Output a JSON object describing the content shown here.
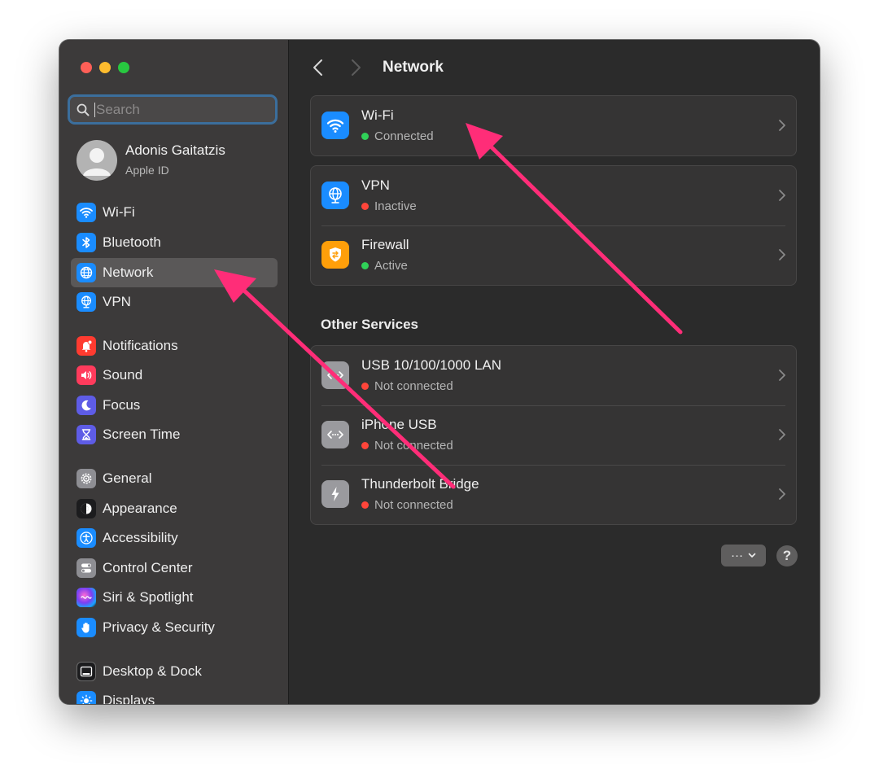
{
  "window": {
    "title": "Network",
    "sidebar": {
      "search_placeholder": "Search",
      "profile": {
        "name": "Adonis Gaitatzis",
        "subtitle": "Apple ID"
      },
      "items": [
        {
          "label": "Wi-Fi",
          "icon": "wifi-icon"
        },
        {
          "label": "Bluetooth",
          "icon": "bluetooth-icon"
        },
        {
          "label": "Network",
          "icon": "globe-icon",
          "selected": true
        },
        {
          "label": "VPN",
          "icon": "vpn-globe-icon"
        },
        {
          "label": "Notifications",
          "icon": "bell-icon"
        },
        {
          "label": "Sound",
          "icon": "speaker-icon"
        },
        {
          "label": "Focus",
          "icon": "moon-icon"
        },
        {
          "label": "Screen Time",
          "icon": "hourglass-icon"
        },
        {
          "label": "General",
          "icon": "gear-icon"
        },
        {
          "label": "Appearance",
          "icon": "appearance-icon"
        },
        {
          "label": "Accessibility",
          "icon": "accessibility-icon"
        },
        {
          "label": "Control Center",
          "icon": "toggles-icon"
        },
        {
          "label": "Siri & Spotlight",
          "icon": "siri-icon"
        },
        {
          "label": "Privacy & Security",
          "icon": "hand-icon"
        },
        {
          "label": "Desktop & Dock",
          "icon": "dock-icon"
        },
        {
          "label": "Displays",
          "icon": "sun-icon"
        }
      ]
    },
    "main": {
      "services": [
        {
          "title": "Wi-Fi",
          "status": "Connected",
          "status_color": "#30d158",
          "icon": "wifi-icon"
        }
      ],
      "security": [
        {
          "title": "VPN",
          "status": "Inactive",
          "status_color": "#ff453a",
          "icon": "vpn-globe-icon"
        },
        {
          "title": "Firewall",
          "status": "Active",
          "status_color": "#30d158",
          "icon": "firewall-icon"
        }
      ],
      "other_services_title": "Other Services",
      "other_services": [
        {
          "title": "USB 10/100/1000 LAN",
          "status": "Not connected",
          "status_color": "#ff453a",
          "icon": "ethernet-icon"
        },
        {
          "title": "iPhone USB",
          "status": "Not connected",
          "status_color": "#ff453a",
          "icon": "ethernet-icon"
        },
        {
          "title": "Thunderbolt Bridge",
          "status": "Not connected",
          "status_color": "#ff453a",
          "icon": "thunderbolt-icon"
        }
      ],
      "more_button": "···",
      "help_button": "?"
    },
    "annotation_color": "#ff2d78"
  }
}
